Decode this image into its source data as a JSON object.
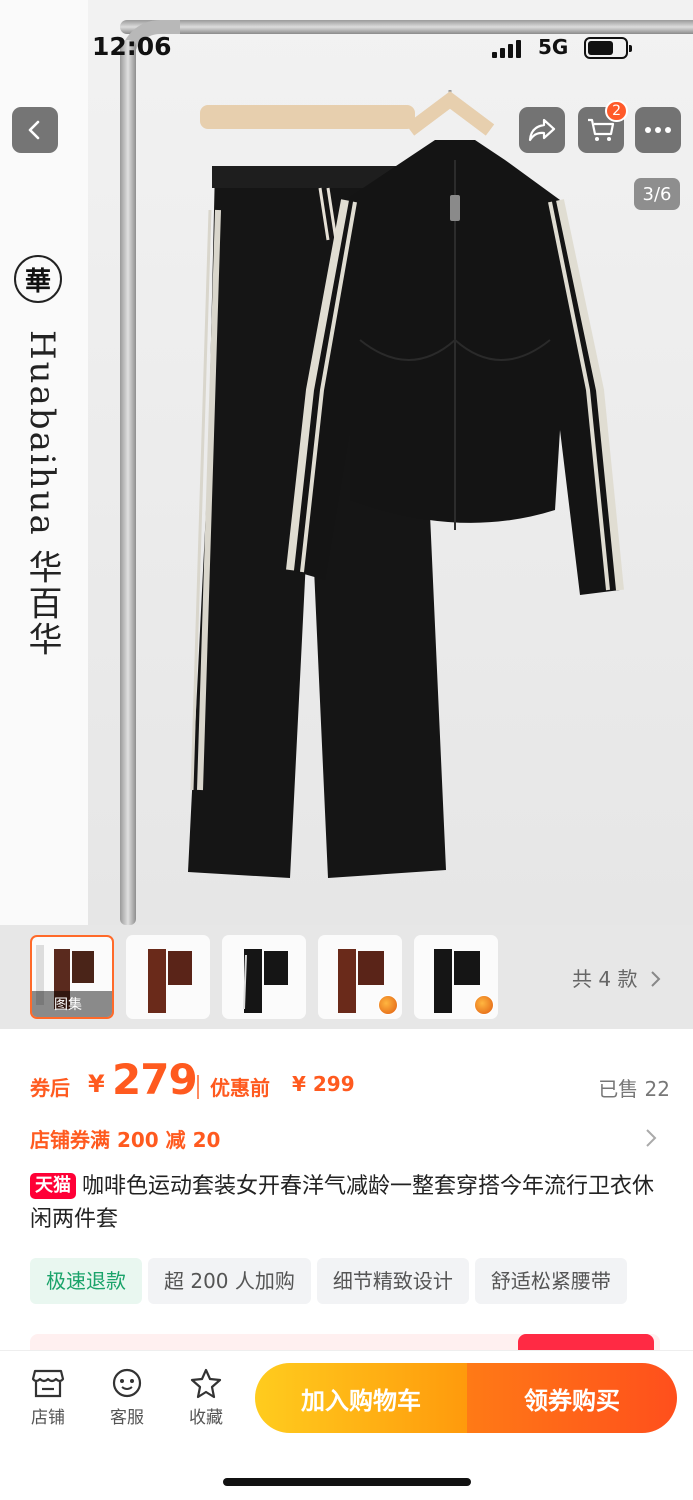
{
  "status_bar": {
    "time": "12:06",
    "network": "5G",
    "battery_icon": "battery-icon",
    "signal_icon": "signal-icon"
  },
  "hero": {
    "brand_name": "Huabaihua 华百华",
    "seal_text": "華",
    "image_counter": "3/6",
    "cart_badge": "2",
    "icons": [
      "back-icon",
      "share-icon",
      "cart-icon",
      "more-icon"
    ]
  },
  "thumbnails": {
    "first_label": "图集",
    "variants_label": "共 4 款"
  },
  "price": {
    "after_coupon_label": "券后",
    "currency": "¥",
    "price": "279",
    "before_label": "优惠前",
    "before_price": "¥ 299",
    "sold": "已售 22",
    "accent_color": "#ff5a1f"
  },
  "coupon": {
    "text": "店铺券满 200 减 20"
  },
  "product": {
    "platform_badge": "天猫",
    "title": "咖啡色运动套装女开春洋气减龄一整套穿搭今年流行卫衣休闲两件套"
  },
  "tags": [
    "极速退款",
    "超 200 人加购",
    "细节精致设计",
    "舒适松紧腰带"
  ],
  "bottom_bar": {
    "store_label": "店铺",
    "service_label": "客服",
    "favorite_label": "收藏",
    "add_to_cart": "加入购物车",
    "buy_now": "领券购买"
  }
}
